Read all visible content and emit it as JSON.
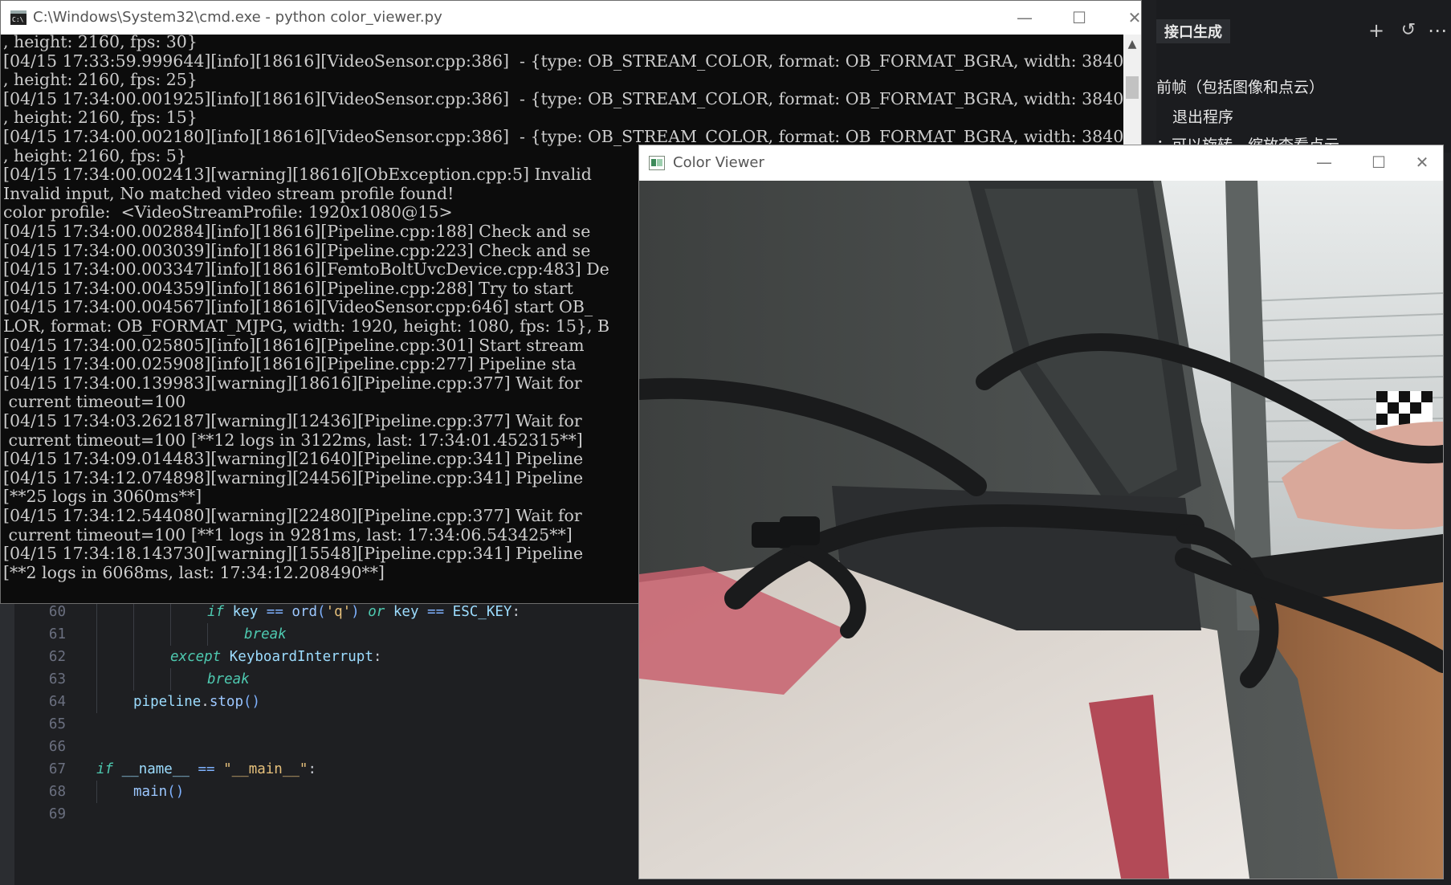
{
  "editor": {
    "lines": [
      {
        "n": "60",
        "indent": 3,
        "tokens": [
          [
            "kw",
            "if"
          ],
          [
            "",
            " "
          ],
          [
            "var",
            "key"
          ],
          [
            "",
            " "
          ],
          [
            "op",
            "=="
          ],
          [
            "",
            " "
          ],
          [
            "fn",
            "ord"
          ],
          [
            "op",
            "("
          ],
          [
            "str",
            "'q'"
          ],
          [
            "op",
            ")"
          ],
          [
            "",
            " "
          ],
          [
            "kw",
            "or"
          ],
          [
            "",
            " "
          ],
          [
            "var",
            "key"
          ],
          [
            "",
            " "
          ],
          [
            "op",
            "=="
          ],
          [
            "",
            " "
          ],
          [
            "var",
            "ESC_KEY"
          ],
          [
            "",
            ":"
          ]
        ]
      },
      {
        "n": "61",
        "indent": 4,
        "tokens": [
          [
            "kw",
            "break"
          ]
        ]
      },
      {
        "n": "62",
        "indent": 2,
        "tokens": [
          [
            "kw",
            "except"
          ],
          [
            "",
            " "
          ],
          [
            "var",
            "KeyboardInterrupt"
          ],
          [
            "",
            ":"
          ]
        ]
      },
      {
        "n": "63",
        "indent": 3,
        "tokens": [
          [
            "kw",
            "break"
          ]
        ]
      },
      {
        "n": "64",
        "indent": 1,
        "tokens": [
          [
            "var",
            "pipeline"
          ],
          [
            "",
            "."
          ],
          [
            "fn",
            "stop"
          ],
          [
            "op",
            "()"
          ]
        ]
      },
      {
        "n": "65",
        "indent": 0,
        "tokens": []
      },
      {
        "n": "66",
        "indent": 0,
        "tokens": []
      },
      {
        "n": "67",
        "indent": 0,
        "tokens": [
          [
            "kw",
            "if"
          ],
          [
            "",
            " "
          ],
          [
            "var",
            "__name__"
          ],
          [
            "",
            " "
          ],
          [
            "op",
            "=="
          ],
          [
            "",
            " "
          ],
          [
            "str",
            "\"__main__\""
          ],
          [
            "",
            ":"
          ]
        ]
      },
      {
        "n": "68",
        "indent": 1,
        "tokens": [
          [
            "fn",
            "main"
          ],
          [
            "op",
            "()"
          ]
        ]
      },
      {
        "n": "69",
        "indent": 0,
        "tokens": []
      }
    ]
  },
  "side_panel": {
    "title": "接口生成",
    "line1": "前帧（包括图像和点云）",
    "line2": "退出程序",
    "line3": "：可以旋转、缩放查看点云",
    "icons": [
      "plus-icon",
      "history-icon",
      "more-icon"
    ],
    "plus_glyph": "+",
    "history_glyph": "↺",
    "more_glyph": "⋯"
  },
  "cmd": {
    "title": "C:\\Windows\\System32\\cmd.exe - python  color_viewer.py",
    "minimize": "—",
    "maximize": "☐",
    "close": "✕",
    "log_lines": [
      ", height: 2160, fps: 30}",
      "[04/15 17:33:59.999644][info][18616][VideoSensor.cpp:386]  - {type: OB_STREAM_COLOR, format: OB_FORMAT_BGRA, width: 3840",
      ", height: 2160, fps: 25}",
      "[04/15 17:34:00.001925][info][18616][VideoSensor.cpp:386]  - {type: OB_STREAM_COLOR, format: OB_FORMAT_BGRA, width: 3840",
      ", height: 2160, fps: 15}",
      "[04/15 17:34:00.002180][info][18616][VideoSensor.cpp:386]  - {type: OB_STREAM_COLOR, format: OB_FORMAT_BGRA, width: 3840",
      ", height: 2160, fps: 5}",
      "[04/15 17:34:00.002413][warning][18616][ObException.cpp:5] Invalid",
      "Invalid input, No matched video stream profile found!",
      "color profile:  <VideoStreamProfile: 1920x1080@15>",
      "[04/15 17:34:00.002884][info][18616][Pipeline.cpp:188] Check and se",
      "[04/15 17:34:00.003039][info][18616][Pipeline.cpp:223] Check and se",
      "[04/15 17:34:00.003347][info][18616][FemtoBoltUvcDevice.cpp:483] De",
      "[04/15 17:34:00.004359][info][18616][Pipeline.cpp:288] Try to start",
      "[04/15 17:34:00.004567][info][18616][VideoSensor.cpp:646] start OB_",
      "LOR, format: OB_FORMAT_MJPG, width: 1920, height: 1080, fps: 15}, B",
      "[04/15 17:34:00.025805][info][18616][Pipeline.cpp:301] Start stream",
      "[04/15 17:34:00.025908][info][18616][Pipeline.cpp:277] Pipeline sta",
      "[04/15 17:34:00.139983][warning][18616][Pipeline.cpp:377] Wait for",
      " current timeout=100",
      "[04/15 17:34:03.262187][warning][12436][Pipeline.cpp:377] Wait for",
      " current timeout=100 [**12 logs in 3122ms, last: 17:34:01.452315**]",
      "[04/15 17:34:09.014483][warning][21640][Pipeline.cpp:341] Pipeline",
      "[04/15 17:34:12.074898][warning][24456][Pipeline.cpp:341] Pipeline",
      "[**25 logs in 3060ms**]",
      "[04/15 17:34:12.544080][warning][22480][Pipeline.cpp:377] Wait for",
      " current timeout=100 [**1 logs in 9281ms, last: 17:34:06.543425**]",
      "[04/15 17:34:18.143730][warning][15548][Pipeline.cpp:341] Pipeline",
      "[**2 logs in 6068ms, last: 17:34:12.208490**]"
    ],
    "scroll_up": "▲"
  },
  "viewer": {
    "title": "Color Viewer",
    "minimize": "—",
    "maximize": "☐",
    "close": "✕"
  },
  "colors": {
    "cmd_bg": "#0c0c0c",
    "cmd_text": "#cccccc",
    "editor_bg": "#1e1f22"
  }
}
